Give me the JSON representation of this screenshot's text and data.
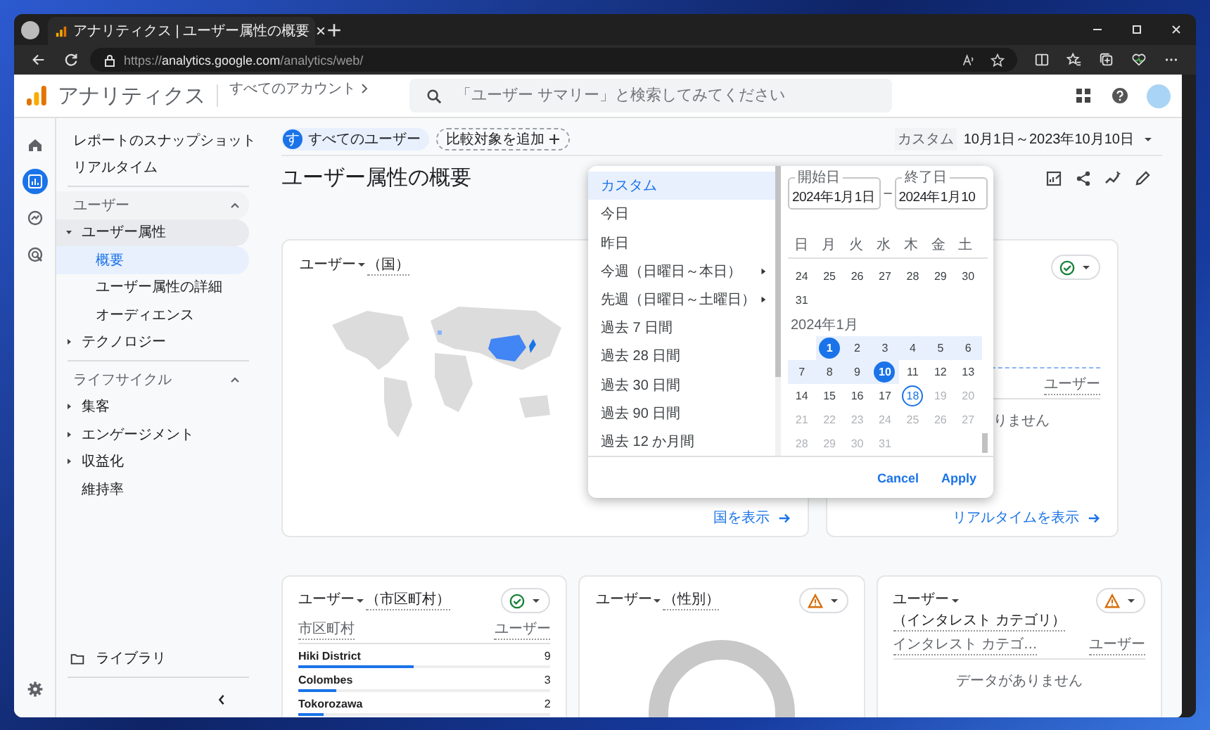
{
  "browser": {
    "tab_title": "アナリティクス | ユーザー属性の概要",
    "url_scheme": "https://",
    "url_host": "analytics.google.com",
    "url_path": "/analytics/web/"
  },
  "header": {
    "product": "アナリティクス",
    "account": "すべてのアカウント",
    "search_placeholder": "「ユーザー サマリー」と検索してみてください"
  },
  "rail": [
    {
      "kind": "home",
      "selected": false
    },
    {
      "kind": "reports",
      "selected": true
    },
    {
      "kind": "explore",
      "selected": false
    },
    {
      "kind": "advertising",
      "selected": false
    }
  ],
  "sidebar": {
    "top_items": [
      {
        "label": "レポートのスナップショット",
        "selected": false
      },
      {
        "label": "リアルタイム",
        "selected": false
      }
    ],
    "sections": [
      {
        "title": "ユーザー",
        "expanded": true,
        "items": [
          {
            "label": "ユーザー属性",
            "expanded": true,
            "selected": false,
            "children": [
              {
                "label": "概要",
                "selected": true
              },
              {
                "label": "ユーザー属性の詳細",
                "selected": false
              },
              {
                "label": "オーディエンス",
                "selected": false
              }
            ]
          },
          {
            "label": "テクノロジー",
            "expanded": false,
            "selected": false
          }
        ]
      },
      {
        "title": "ライフサイクル",
        "expanded": true,
        "items": [
          {
            "label": "集客",
            "expanded": false,
            "selected": false
          },
          {
            "label": "エンゲージメント",
            "expanded": false,
            "selected": false
          },
          {
            "label": "収益化",
            "expanded": false,
            "selected": false
          },
          {
            "label": "維持率",
            "selected": false
          }
        ]
      }
    ],
    "library": "ライブラリ"
  },
  "toolbar": {
    "segment_initial": "す",
    "segment": "すべてのユーザー",
    "compare": "比較対象を追加",
    "range_label": "カスタム",
    "range": "10月1日～2023年10月10日"
  },
  "page_title": "ユーザー属性の概要",
  "top_cards": [
    {
      "kind": "map",
      "title": "ユーザー",
      "dimension": "（国）",
      "link": "国を表示"
    },
    {
      "kind": "table",
      "warning": false,
      "columns": [
        "ユーザー"
      ],
      "message": "りません",
      "link": "リアルタイムを表示"
    }
  ],
  "bottom_cards": [
    {
      "kind": "table",
      "title": "ユーザー",
      "dimension": "（市区町村）",
      "warning": false,
      "columns": [
        "市区町村",
        "ユーザー"
      ],
      "rows": [
        {
          "name": "Hiki District",
          "value": "9",
          "level": 0.46
        },
        {
          "name": "Colombes",
          "value": "3",
          "level": 0.15
        },
        {
          "name": "Tokorozawa",
          "value": "2",
          "level": 0.1
        }
      ]
    },
    {
      "kind": "donut",
      "title": "ユーザー",
      "dimension": "（性別）",
      "warning": true
    },
    {
      "kind": "table",
      "title": "ユーザー",
      "dimension": "（インタレスト カテゴリ）",
      "warning": true,
      "columns": [
        "インタレスト カテゴ…",
        "ユーザー"
      ],
      "message": "データがありません"
    }
  ],
  "date_picker": {
    "presets": [
      {
        "label": "カスタム",
        "selected": true,
        "submenu": false
      },
      {
        "label": "今日",
        "selected": false,
        "submenu": false
      },
      {
        "label": "昨日",
        "selected": false,
        "submenu": false
      },
      {
        "label": "今週（日曜日～本日）",
        "selected": false,
        "submenu": true
      },
      {
        "label": "先週（日曜日～土曜日）",
        "selected": false,
        "submenu": true
      },
      {
        "label": "過去 7 日間",
        "selected": false,
        "submenu": false
      },
      {
        "label": "過去 28 日間",
        "selected": false,
        "submenu": false
      },
      {
        "label": "過去 30 日間",
        "selected": false,
        "submenu": false
      },
      {
        "label": "過去 90 日間",
        "selected": false,
        "submenu": false
      },
      {
        "label": "過去 12 か月間",
        "selected": false,
        "submenu": false
      }
    ],
    "start_label": "開始日",
    "start_value": "2024年1月1日",
    "separator": "–",
    "end_label": "終了日",
    "end_value": "2024年1月10",
    "weekdays": [
      "日",
      "月",
      "火",
      "水",
      "木",
      "金",
      "土"
    ],
    "months": [
      {
        "weeks": [
          {
            "leading_blank": false,
            "days": [
              {
                "day": "24",
                "kind": "normal"
              },
              {
                "day": "25",
                "kind": "normal"
              },
              {
                "day": "26",
                "kind": "normal"
              },
              {
                "day": "27",
                "kind": "normal"
              },
              {
                "day": "28",
                "kind": "normal"
              },
              {
                "day": "29",
                "kind": "normal"
              },
              {
                "day": "30",
                "kind": "normal"
              }
            ]
          },
          {
            "leading_blank": false,
            "days": [
              {
                "day": "31",
                "kind": "normal"
              }
            ]
          }
        ]
      },
      {
        "label": "2024年1月",
        "weeks": [
          {
            "leading_blank": true,
            "days": [
              {
                "day": "1",
                "kind": "endpoint"
              },
              {
                "day": "2",
                "kind": "range"
              },
              {
                "day": "3",
                "kind": "range"
              },
              {
                "day": "4",
                "kind": "range"
              },
              {
                "day": "5",
                "kind": "range"
              },
              {
                "day": "6",
                "kind": "range"
              }
            ]
          },
          {
            "leading_blank": false,
            "days": [
              {
                "day": "7",
                "kind": "range"
              },
              {
                "day": "8",
                "kind": "range"
              },
              {
                "day": "9",
                "kind": "range"
              },
              {
                "day": "10",
                "kind": "endpoint"
              },
              {
                "day": "11",
                "kind": "normal"
              },
              {
                "day": "12",
                "kind": "normal"
              },
              {
                "day": "13",
                "kind": "normal"
              }
            ]
          },
          {
            "leading_blank": false,
            "days": [
              {
                "day": "14",
                "kind": "normal"
              },
              {
                "day": "15",
                "kind": "normal"
              },
              {
                "day": "16",
                "kind": "normal"
              },
              {
                "day": "17",
                "kind": "normal"
              },
              {
                "day": "18",
                "kind": "today"
              },
              {
                "day": "19",
                "kind": "future"
              },
              {
                "day": "20",
                "kind": "future"
              }
            ]
          },
          {
            "leading_blank": false,
            "days": [
              {
                "day": "21",
                "kind": "future"
              },
              {
                "day": "22",
                "kind": "future"
              },
              {
                "day": "23",
                "kind": "future"
              },
              {
                "day": "24",
                "kind": "future"
              },
              {
                "day": "25",
                "kind": "future"
              },
              {
                "day": "26",
                "kind": "future"
              },
              {
                "day": "27",
                "kind": "future"
              }
            ]
          },
          {
            "leading_blank": false,
            "days": [
              {
                "day": "28",
                "kind": "future"
              },
              {
                "day": "29",
                "kind": "future"
              },
              {
                "day": "30",
                "kind": "future"
              },
              {
                "day": "31",
                "kind": "future"
              }
            ]
          }
        ]
      }
    ],
    "cancel": "Cancel",
    "apply": "Apply"
  }
}
